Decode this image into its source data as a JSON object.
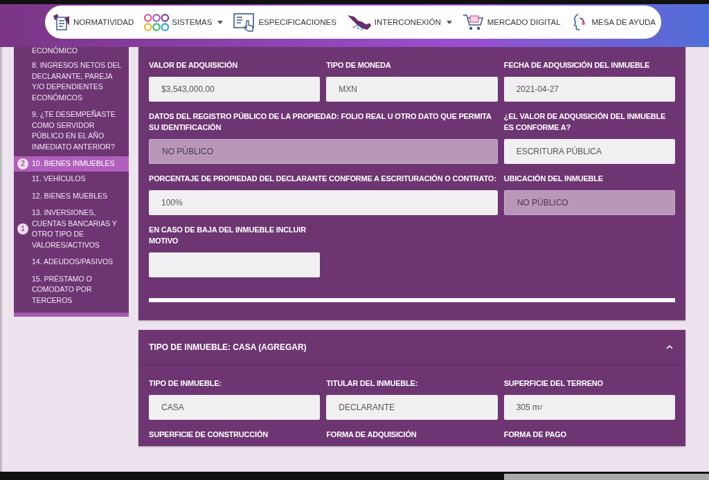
{
  "nav": {
    "items": [
      {
        "kind": "document",
        "label": "NORMATIVIDAD",
        "dropdown": false
      },
      {
        "kind": "circles",
        "label": "SISTEMAS",
        "dropdown": true
      },
      {
        "kind": "screen",
        "label": "ESPECIFICACIONES",
        "dropdown": false
      },
      {
        "kind": "map",
        "label": "INTERCONEXIÓN",
        "dropdown": true
      },
      {
        "kind": "cart",
        "label": "MERCADO DIGITAL",
        "dropdown": false
      },
      {
        "kind": "support",
        "label": "MESA DE AYUDA",
        "dropdown": false
      }
    ]
  },
  "sidebar": {
    "items": [
      {
        "label": "ECONÓMICO",
        "selected": false
      },
      {
        "label": "8. INGRESOS NETOS DEL DECLARANTE, PAREJA Y/O DEPENDIENTES ECONÓMICOS",
        "selected": false
      },
      {
        "label": "9. ¿TE DESEMPEÑASTE COMO SERVIDOR PÚBLICO EN EL AÑO INMEDIATO ANTERIOR?",
        "selected": false
      },
      {
        "label": "10. BIENES INMUEBLES",
        "selected": true,
        "badge": "2"
      },
      {
        "label": "11. VEHÍCULOS",
        "selected": false
      },
      {
        "label": "12. BIENES MUEBLES",
        "selected": false
      },
      {
        "label": "13. INVERSIONES, CUENTAS BANCARIAS Y OTRO TIPO DE VALORES/ACTIVOS",
        "selected": false,
        "badge": "1"
      },
      {
        "label": "14. ADEUDOS/PASIVOS",
        "selected": false
      },
      {
        "label": "15. PRÉSTAMO O COMODATO POR TERCEROS",
        "selected": false
      }
    ]
  },
  "sections": [
    {
      "fields": [
        {
          "label": "VALOR DE ADQUISICIÓN",
          "value": "$3,543,000.00",
          "disabled": false,
          "wide": false
        },
        {
          "label": "TIPO DE MONEDA",
          "value": "MXN",
          "disabled": false,
          "wide": false
        },
        {
          "label": "FECHA DE ADQUISICIÓN DEL INMUEBLE",
          "value": "2021-04-27",
          "disabled": false,
          "wide": false
        },
        {
          "label": "DATOS DEL REGISTRO PÚBLICO DE LA PROPIEDAD: FOLIO REAL U OTRO DATO QUE PERMITA SU IDENTIFICACIÓN",
          "value": "NO PÚBLICO",
          "disabled": true,
          "wide": true
        },
        {
          "label": "¿EL VALOR DE ADQUISICIÓN DEL INMUEBLE ES CONFORME A?",
          "value": "ESCRITURA PÚBLICA",
          "disabled": false,
          "wide": false
        },
        {
          "label": "PORCENTAJE DE PROPIEDAD DEL DECLARANTE CONFORME A ESCRITURACIÓN O CONTRATO:",
          "value": "100%",
          "disabled": false,
          "wide": true
        },
        {
          "label": "UBICACIÓN DEL INMUEBLE",
          "value": "NO PÚBLICO",
          "disabled": true,
          "wide": false
        },
        {
          "label": "EN CASO DE BAJA DEL INMUEBLE INCLUIR MOTIVO",
          "disabled": false,
          "wide": false
        }
      ]
    },
    {
      "title": "TIPO DE INMUEBLE: CASA (AGREGAR)",
      "expanded": true,
      "fields": [
        {
          "label": "TIPO DE INMUEBLE:",
          "value": "CASA",
          "disabled": false,
          "wide": false
        },
        {
          "label": "TITULAR DEL INMUEBLE:",
          "value": "DECLARANTE",
          "disabled": false,
          "wide": false
        },
        {
          "label": "SUPERFICIE DEL TERRENO",
          "value": "305 m$^{2}$",
          "disabled": false,
          "wide": false
        },
        {
          "label": "SUPERFICIE DE CONSTRUCCIÓN"
        },
        {
          "label": "FORMA DE ADQUISICIÓN"
        },
        {
          "label": "FORMA DE PAGO"
        }
      ]
    }
  ]
}
